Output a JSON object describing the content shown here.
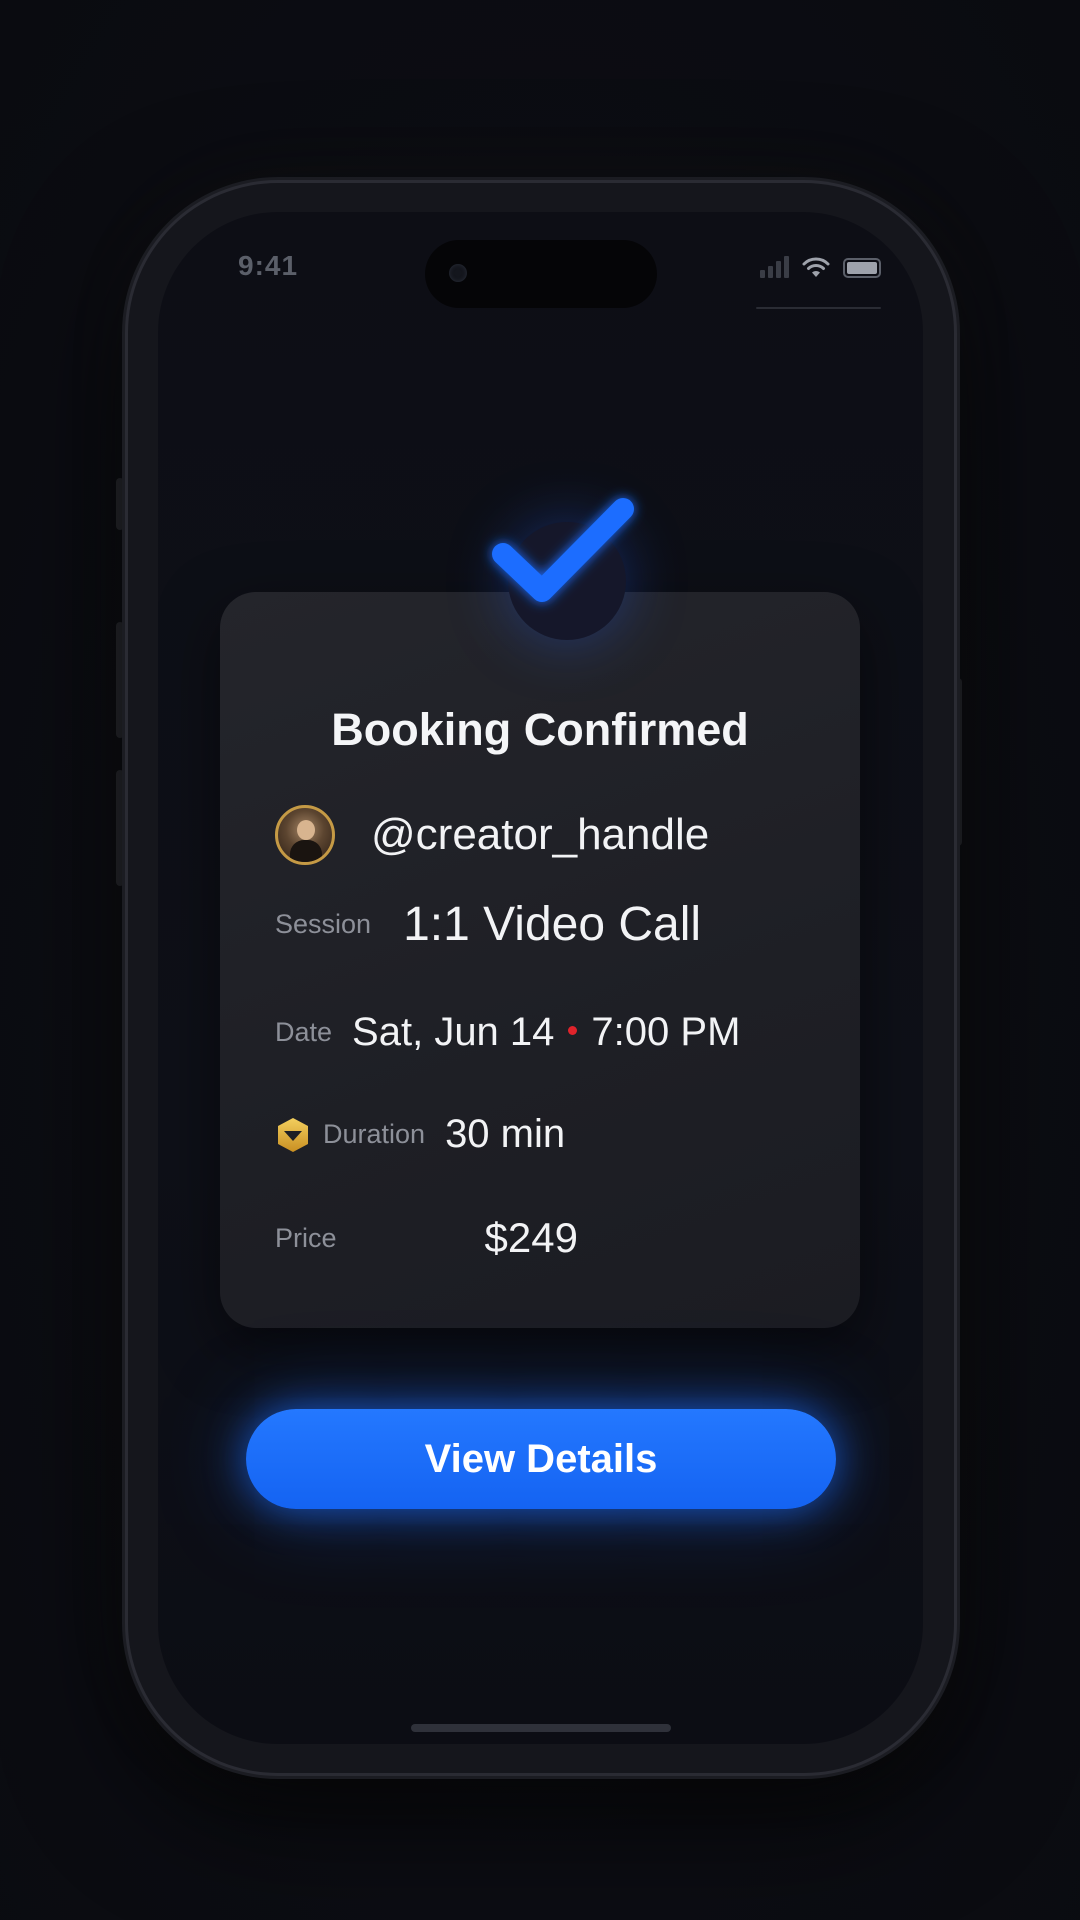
{
  "status_bar": {
    "time": "9:41"
  },
  "confirmation": {
    "title": "Booking Confirmed",
    "creator_handle": "@creator_handle",
    "session": {
      "label": "Session",
      "value": "1:1 Video Call"
    },
    "date": {
      "label": "Date",
      "day": "Sat, Jun 14",
      "time": "7:00 PM"
    },
    "duration": {
      "label": "Duration",
      "value": "30 min",
      "icon": "gold-badge-icon"
    },
    "price": {
      "label": "Price",
      "value": "$249"
    }
  },
  "actions": {
    "view_details_label": "View Details"
  },
  "colors": {
    "accent": "#1a6dff",
    "background": "#0d0e15",
    "card": "#202127",
    "gold": "#e2b23c",
    "separator_dot": "#e0232b"
  }
}
